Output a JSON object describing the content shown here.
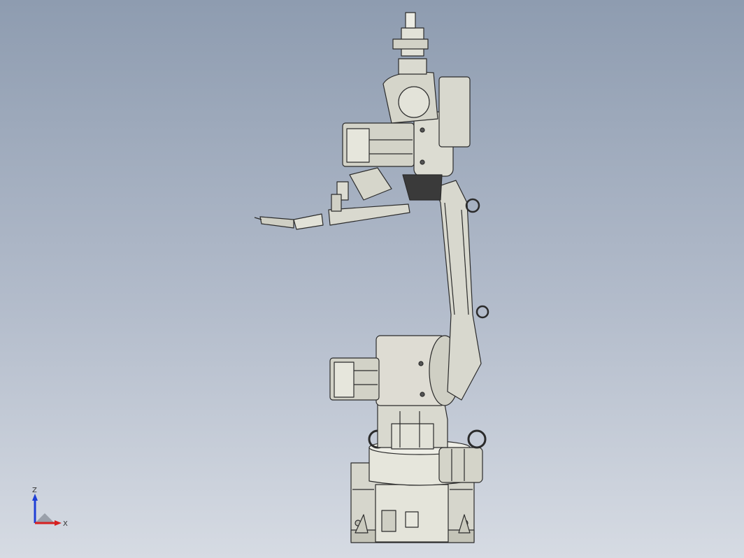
{
  "viewport": {
    "background_top": "#8e9cb0",
    "background_bottom": "#d6dbe3",
    "model_fill": "#dcdcd2",
    "model_edge": "#2b2b2b",
    "model_shadow": "#a9a99e"
  },
  "triad": {
    "z_label": "Z",
    "x_label": "X",
    "z_color": "#1f3fd6",
    "x_color": "#d62020"
  }
}
